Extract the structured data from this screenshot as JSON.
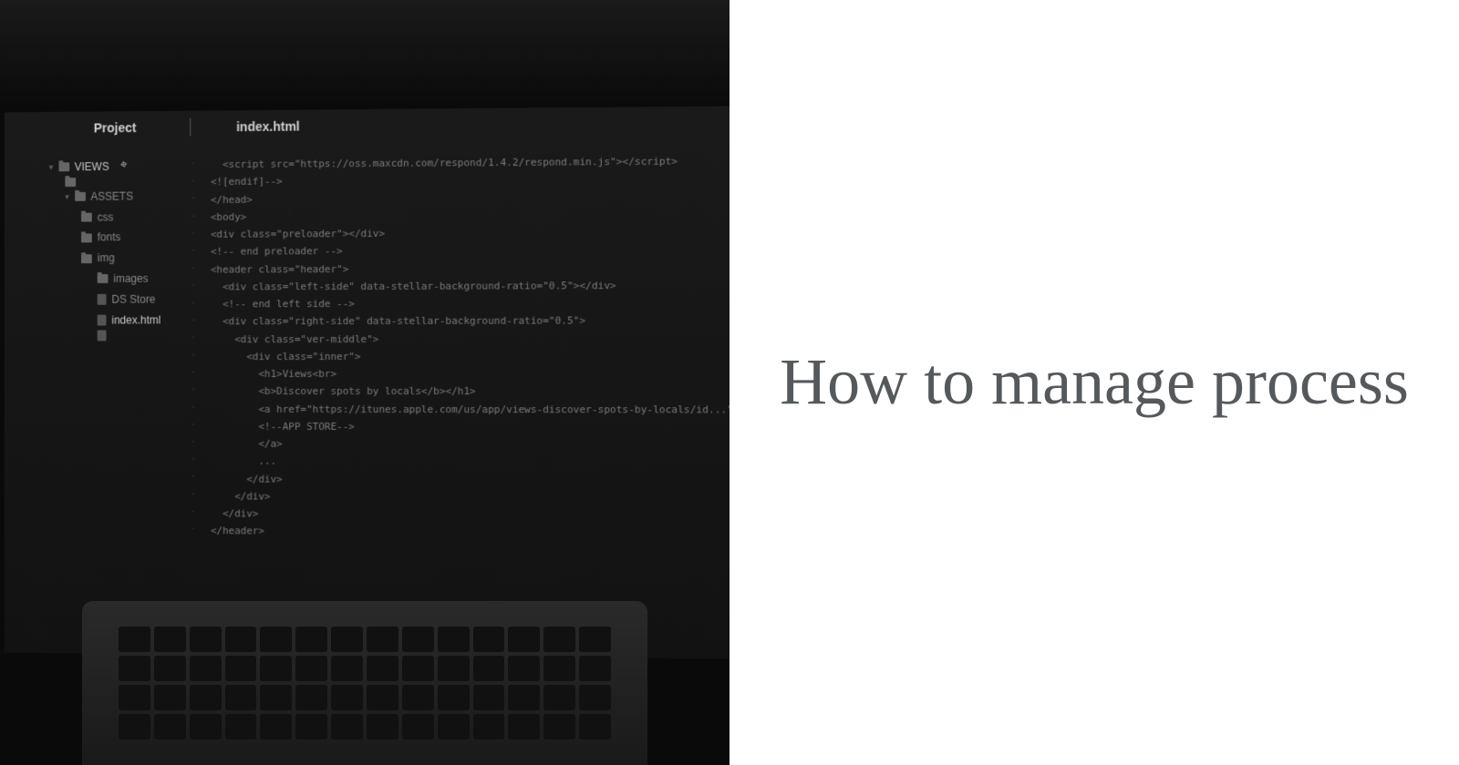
{
  "title": "How to manage process",
  "editor": {
    "project_label": "Project",
    "tab_label": "index.html",
    "tree": {
      "root": "VIEWS",
      "items": [
        {
          "level": 1,
          "type": "folder",
          "label": "VIEWS",
          "expanded": true,
          "active": true
        },
        {
          "level": 2,
          "type": "folder",
          "label": ""
        },
        {
          "level": 2,
          "type": "folder",
          "label": "ASSETS",
          "expanded": true
        },
        {
          "level": 3,
          "type": "folder",
          "label": "css"
        },
        {
          "level": 3,
          "type": "folder",
          "label": "fonts"
        },
        {
          "level": 3,
          "type": "folder",
          "label": "img"
        },
        {
          "level": 4,
          "type": "folder",
          "label": "images"
        },
        {
          "level": 4,
          "type": "file",
          "label": "DS Store"
        },
        {
          "level": 4,
          "type": "file",
          "label": "index.html",
          "active": true
        },
        {
          "level": 4,
          "type": "file",
          "label": ""
        }
      ]
    },
    "code_lines": [
      "  <script src=\"https://oss.maxcdn.com/respond/1.4.2/respond.min.js\"></script>",
      "<![endif]-->",
      "</head>",
      "<body>",
      "<div class=\"preloader\"></div>",
      "<!-- end preloader -->",
      "<header class=\"header\">",
      "  <div class=\"left-side\" data-stellar-background-ratio=\"0.5\"></div>",
      "  <!-- end left side -->",
      "  <div class=\"right-side\" data-stellar-background-ratio=\"0.5\">",
      "    <div class=\"ver-middle\">",
      "      <div class=\"inner\">",
      "        <h1>Views<br>",
      "        <b>Discover spots by locals</b></h1>",
      "        <a href=\"https://itunes.apple.com/us/app/views-discover-spots-by-locals/id...\" class=\"...\">",
      "        <!--APP STORE-->",
      "        </a>",
      "        ...",
      "      </div>",
      "    </div>",
      "  </div>",
      "</header>"
    ]
  }
}
